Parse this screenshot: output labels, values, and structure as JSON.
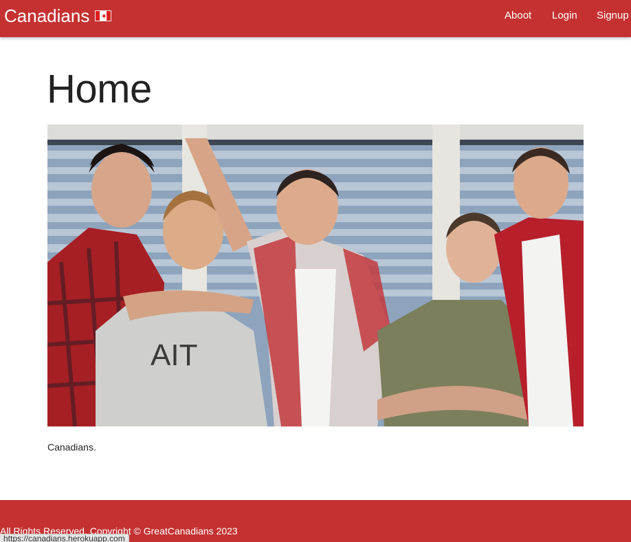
{
  "navbar": {
    "brand": "Canadians",
    "brand_icon": "canada-flag-icon",
    "links": [
      "Aboot",
      "Login",
      "Signup"
    ],
    "color": "#c53131"
  },
  "main": {
    "title": "Home",
    "caption": "Canadians."
  },
  "footer": {
    "text": "All Rights Reserved. Copyright © GreatCanadians 2023",
    "color": "#c53131"
  },
  "status_bar": {
    "url": "https://canadians.herokuapp.com"
  }
}
